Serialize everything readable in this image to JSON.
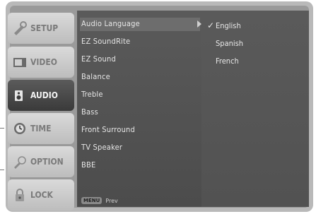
{
  "tabs": [
    {
      "label": "SETUP",
      "icon": "setup-icon"
    },
    {
      "label": "VIDEO",
      "icon": "video-icon"
    },
    {
      "label": "AUDIO",
      "icon": "audio-icon",
      "active": true
    },
    {
      "label": "TIME",
      "icon": "time-icon"
    },
    {
      "label": "OPTION",
      "icon": "option-icon"
    },
    {
      "label": "LOCK",
      "icon": "lock-icon"
    }
  ],
  "menu": {
    "items": [
      "Audio Language",
      "EZ SoundRite",
      "EZ Sound",
      "Balance",
      "Treble",
      "Bass",
      "Front Surround",
      "TV Speaker",
      "BBE"
    ],
    "selected_index": 0,
    "footer_button": "MENU",
    "footer_label": "Prev"
  },
  "submenu": {
    "check_mark": "✓",
    "options": [
      "English",
      "Spanish",
      "French"
    ],
    "selected_index": 0
  }
}
